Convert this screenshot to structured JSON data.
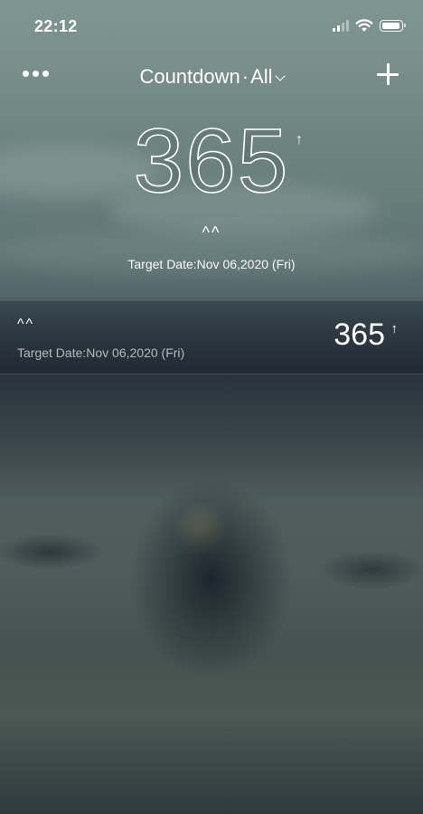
{
  "status_bar": {
    "time": "22:12"
  },
  "nav": {
    "title": "Countdown",
    "separator": "·",
    "filter": "All",
    "more_icon": "ellipsis-icon",
    "add_icon": "plus-icon",
    "dropdown_icon": "chevron-down-icon"
  },
  "hero": {
    "count": "365",
    "direction_arrow": "↑",
    "event_name": "^^",
    "target_date": "Target Date:Nov 06,2020 (Fri)"
  },
  "events": [
    {
      "name": "^^",
      "target_date": "Target Date:Nov 06,2020 (Fri)",
      "count": "365",
      "direction_arrow": "↑"
    }
  ],
  "colors": {
    "text": "#ffffff",
    "row_background": "#2a343c"
  }
}
